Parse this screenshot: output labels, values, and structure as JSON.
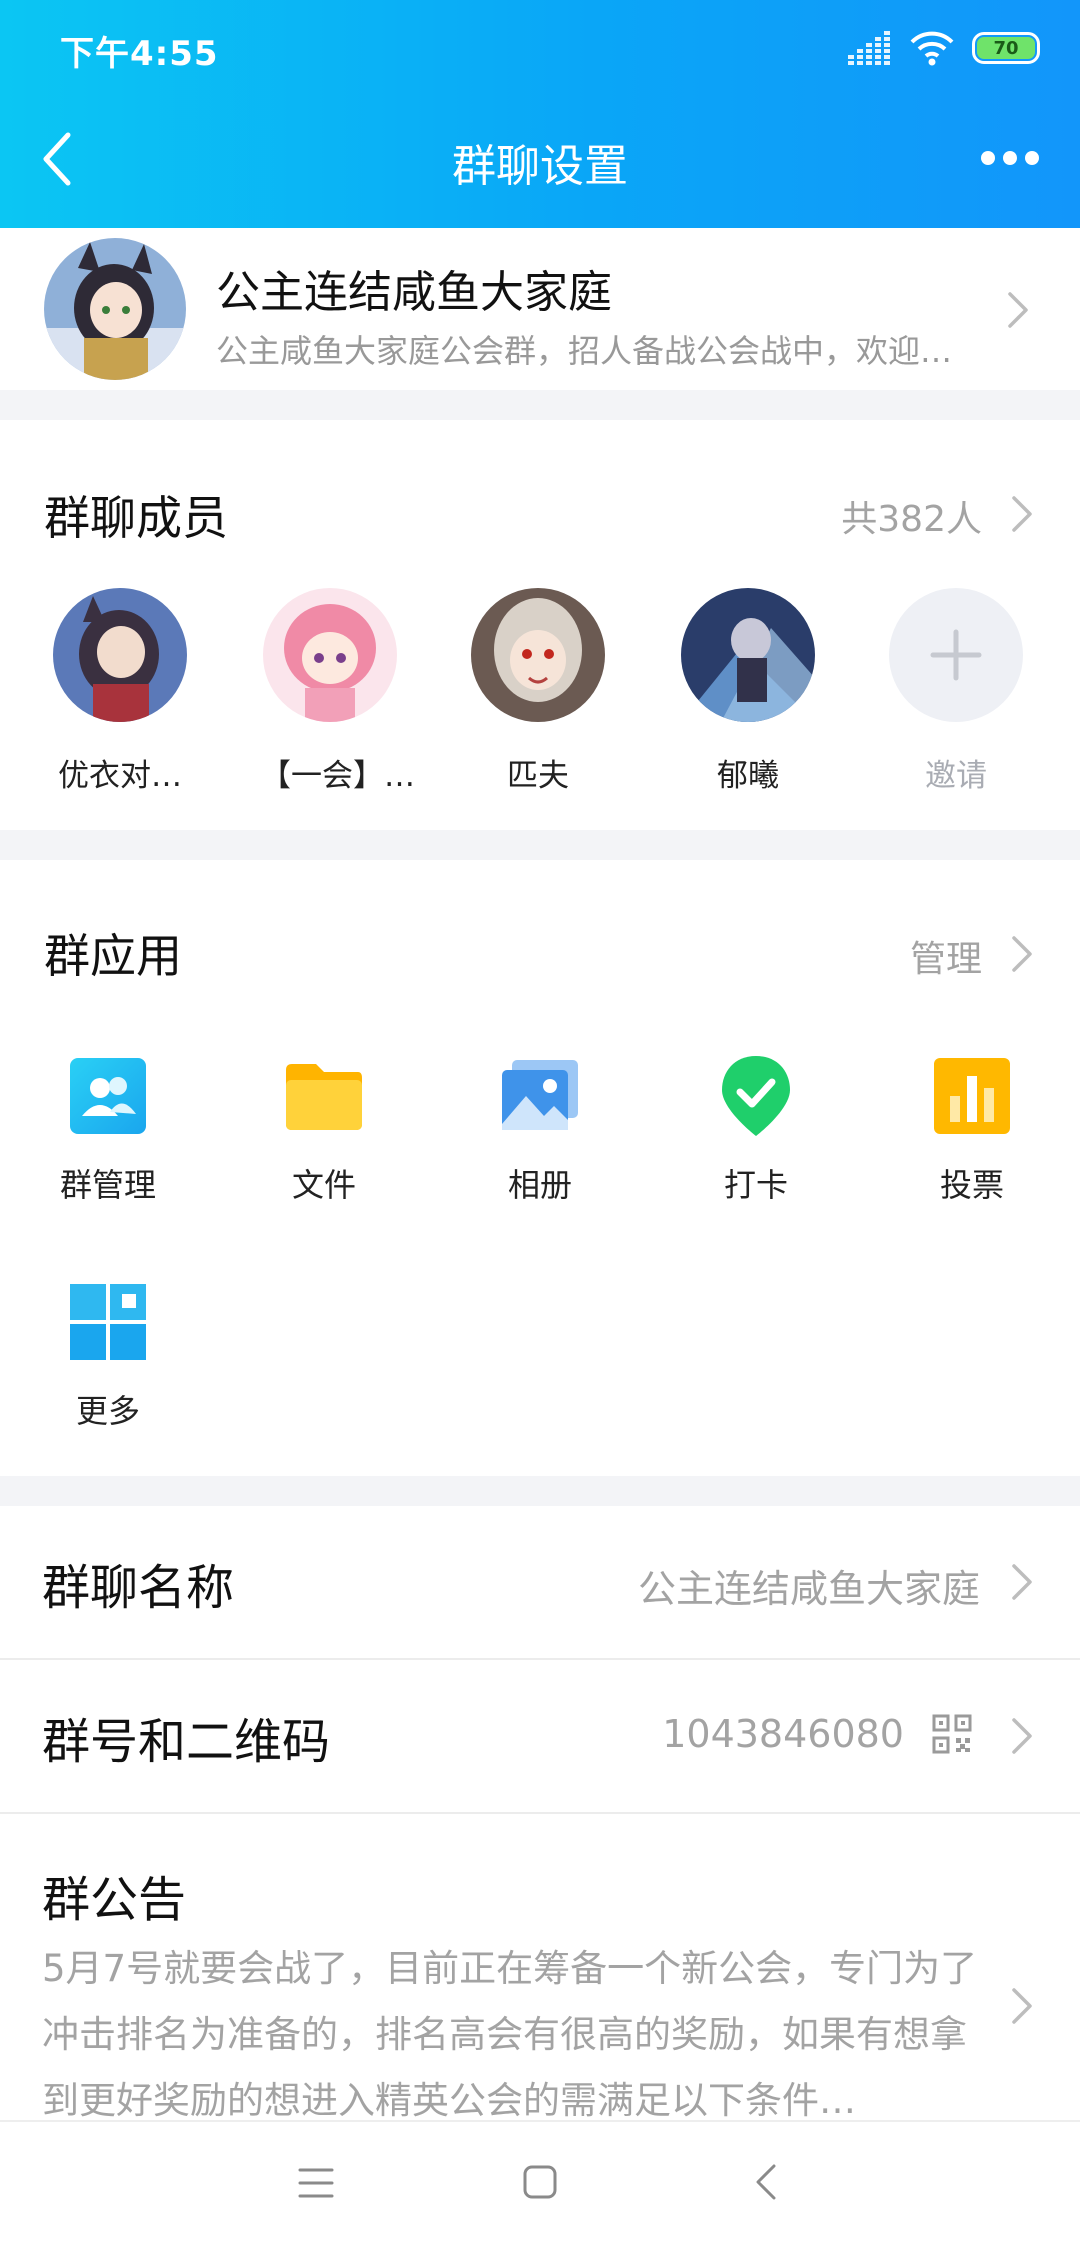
{
  "status_bar": {
    "time": "下午4:55",
    "battery": "70"
  },
  "header": {
    "title": "群聊设置"
  },
  "group": {
    "name": "公主连结咸鱼大家庭",
    "description": "公主咸鱼大家庭公会群，招人备战公会战中，欢迎…"
  },
  "members": {
    "title": "群聊成员",
    "count": "共382人",
    "list": [
      {
        "name": "优衣对…"
      },
      {
        "name": "【一会】…"
      },
      {
        "name": "匹夫"
      },
      {
        "name": "郁曦"
      }
    ],
    "invite_label": "邀请"
  },
  "apps": {
    "title": "群应用",
    "manage": "管理",
    "items": [
      {
        "label": "群管理",
        "icon": "group-manage-icon"
      },
      {
        "label": "文件",
        "icon": "folder-icon"
      },
      {
        "label": "相册",
        "icon": "album-icon"
      },
      {
        "label": "打卡",
        "icon": "checkin-icon"
      },
      {
        "label": "投票",
        "icon": "vote-icon"
      },
      {
        "label": "更多",
        "icon": "more-apps-icon"
      }
    ]
  },
  "settings": {
    "name_label": "群聊名称",
    "name_value": "公主连结咸鱼大家庭",
    "number_label": "群号和二维码",
    "number_value": "1043846080",
    "notice_label": "群公告",
    "notice_text": "5月7号就要会战了，目前正在筹备一个新公会，专门为了冲击排名为准备的，排名高会有很高的奖励，如果有想拿到更好奖励的想进入精英公会的需满足以下条件…"
  },
  "colors": {
    "accent": "#0fb3f5",
    "secondary_text": "#a3a3a3"
  }
}
